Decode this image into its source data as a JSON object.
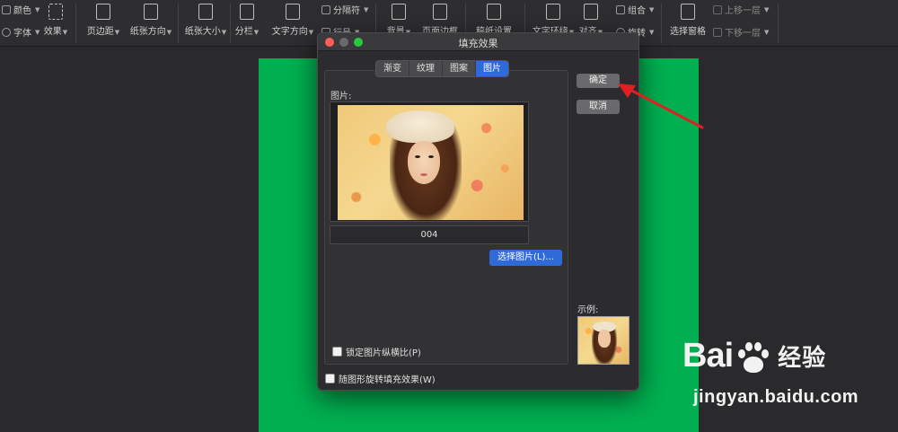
{
  "ribbon": {
    "color_label": "颜色",
    "font_label": "字体",
    "effect_label": "效果",
    "margin_label": "页边距",
    "orientation_label": "纸张方向",
    "size_label": "纸张大小",
    "columns_label": "分栏",
    "text_direction_label": "文字方向",
    "separator_label": "分隔符",
    "line_number_label": "行号",
    "background_label": "背景",
    "page_border_label": "页面边框",
    "grid_paper_label": "稿纸设置",
    "text_wrap_label": "文字环绕",
    "align_label": "对齐",
    "group_label": "组合",
    "rotate_label": "旋转",
    "selection_pane_label": "选择窗格",
    "bring_forward_label": "上移一层",
    "send_backward_label": "下移一层"
  },
  "dialog": {
    "title": "填充效果",
    "tabs": [
      {
        "label": "渐变",
        "active": false
      },
      {
        "label": "纹理",
        "active": false
      },
      {
        "label": "图案",
        "active": false
      },
      {
        "label": "图片",
        "active": true
      }
    ],
    "picture_label": "图片:",
    "picture_name": "004",
    "select_picture_button": "选择图片(L)...",
    "lock_ratio_label": "锁定图片纵横比(P)",
    "rotate_with_shape_label": "随图形旋转填充效果(W)",
    "ok_button": "确定",
    "cancel_button": "取消",
    "sample_label": "示例:"
  },
  "watermark": {
    "brand_left": "Bai",
    "brand_right": "经验",
    "url": "jingyan.baidu.com"
  },
  "colors": {
    "accent": "#2f6ad9",
    "page_fill": "#00b050",
    "annotation_arrow": "#e02020"
  }
}
